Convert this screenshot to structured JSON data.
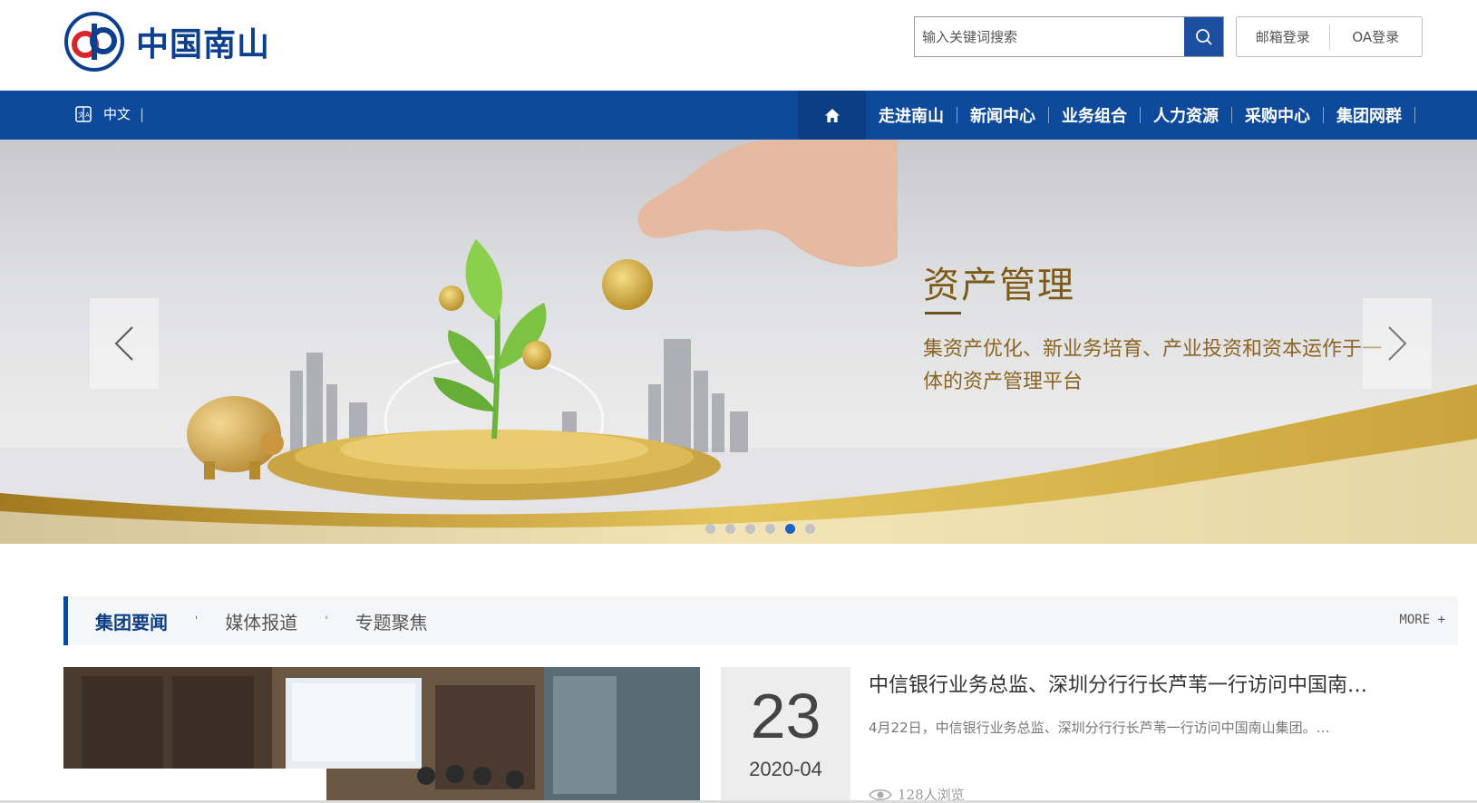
{
  "header": {
    "logo_text": "中国南山",
    "search": {
      "placeholder": "输入关键词搜索"
    },
    "login": {
      "mail": "邮箱登录",
      "oa": "OA登录"
    }
  },
  "nav": {
    "lang": "中文",
    "lang_sep": "|",
    "items": [
      {
        "label": "走进南山"
      },
      {
        "label": "新闻中心"
      },
      {
        "label": "业务组合"
      },
      {
        "label": "人力资源"
      },
      {
        "label": "采购中心"
      },
      {
        "label": "集团网群"
      }
    ]
  },
  "banner": {
    "title": "资产管理",
    "description": "集资产优化、新业务培育、产业投资和资本运作于一体的资产管理平台",
    "slide_count": 6,
    "active_slide_index": 4
  },
  "news": {
    "tabs": [
      {
        "label": "集团要闻"
      },
      {
        "label": "媒体报道"
      },
      {
        "label": "专题聚焦"
      }
    ],
    "more": "MORE +",
    "featured": {
      "day": "23",
      "year_month": "2020-04",
      "title": "中信银行业务总监、深圳分行行长芦苇一行访问中国南…",
      "summary": "4月22日，中信银行业务总监、深圳分行行长芦苇一行访问中国南山集团。…",
      "views": "128人浏览"
    }
  },
  "colors": {
    "brand_blue": "#0e4a9b",
    "accent_gold": "#c9a43a",
    "active_dot": "#1a62c4"
  }
}
